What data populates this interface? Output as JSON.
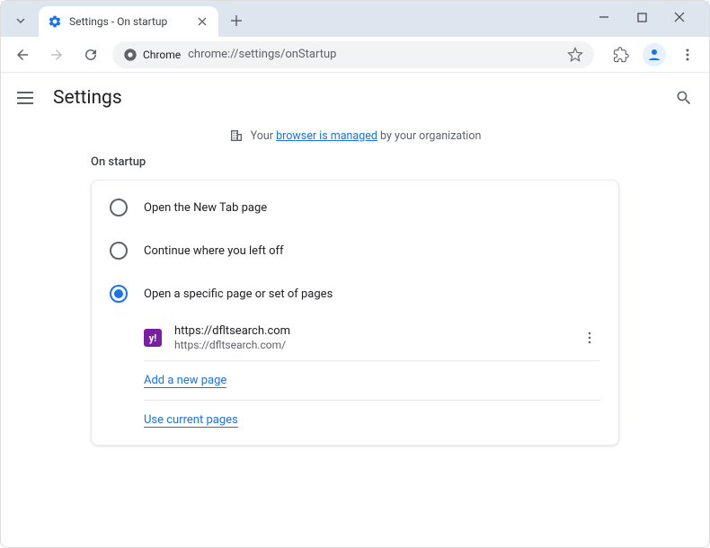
{
  "window": {
    "tab_title": "Settings - On startup"
  },
  "toolbar": {
    "omnibox_label": "Chrome",
    "url": "chrome://settings/onStartup"
  },
  "header": {
    "title": "Settings"
  },
  "managed": {
    "prefix": "Your ",
    "link": "browser is managed",
    "suffix": " by your organization"
  },
  "section": {
    "title": "On startup",
    "options": [
      {
        "label": "Open the New Tab page"
      },
      {
        "label": "Continue where you left off"
      },
      {
        "label": "Open a specific page or set of pages"
      }
    ],
    "startup_page": {
      "title": "https://dfltsearch.com",
      "url": "https://dfltsearch.com/",
      "favicon_letter": "y!"
    },
    "add_link": "Add a new page",
    "use_current_link": "Use current pages"
  }
}
